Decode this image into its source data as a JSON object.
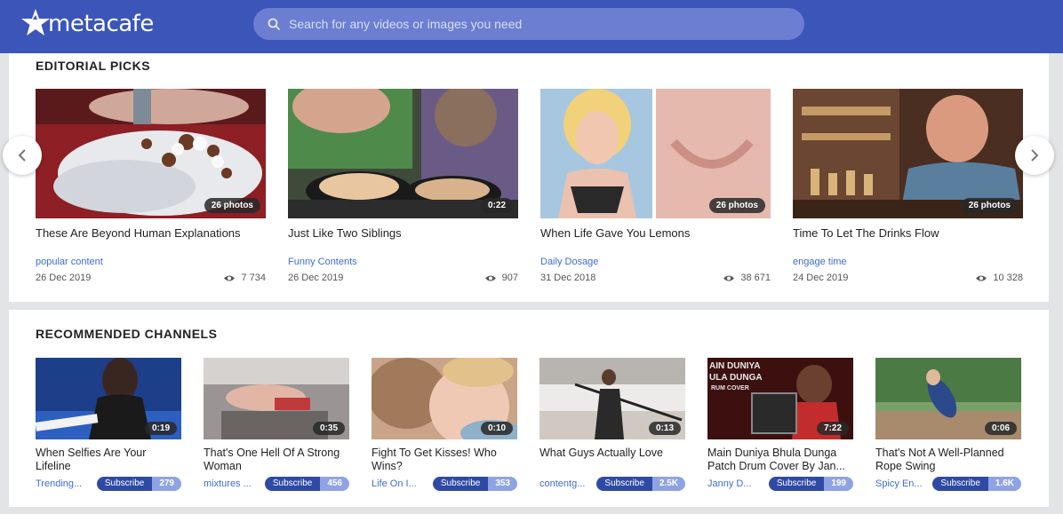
{
  "header": {
    "logo_text": "metacafe",
    "search_placeholder": "Search for any videos or images you need"
  },
  "editorial": {
    "title": "EDITORIAL PICKS",
    "items": [
      {
        "title": "These Are Beyond Human Explanations",
        "badge": "26 photos",
        "category": "popular content",
        "date": "26 Dec 2019",
        "views": "7 734"
      },
      {
        "title": "Just Like Two Siblings",
        "badge": "0:22",
        "category": "Funny Contents",
        "date": "26 Dec 2019",
        "views": "907"
      },
      {
        "title": "When Life Gave You Lemons",
        "badge": "26 photos",
        "category": "Daily Dosage",
        "date": "31 Dec 2018",
        "views": "38 671"
      },
      {
        "title": "Time To Let The Drinks Flow",
        "badge": "26 photos",
        "category": "engage time",
        "date": "24 Dec 2019",
        "views": "10 328"
      }
    ]
  },
  "channels": {
    "title": "RECOMMENDED CHANNELS",
    "subscribe_label": "Subscribe",
    "items": [
      {
        "title": "When Selfies Are Your Lifeline",
        "badge": "0:19",
        "channel": "Trending...",
        "count": "279"
      },
      {
        "title": "That's One Hell Of A Strong Woman",
        "badge": "0:35",
        "channel": "mixtures ...",
        "count": "456"
      },
      {
        "title": "Fight To Get Kisses! Who Wins?",
        "badge": "0:10",
        "channel": "Life On I...",
        "count": "353"
      },
      {
        "title": "What Guys Actually Love",
        "badge": "0:13",
        "channel": "contentg...",
        "count": "2.5K"
      },
      {
        "title": "Main Duniya Bhula Dunga Patch Drum Cover By Jan...",
        "badge": "7:22",
        "channel": "Janny D...",
        "count": "199",
        "thumb_text": [
          "AIN DUNIYA",
          "ULA DUNGA",
          "RUM COVER"
        ]
      },
      {
        "title": "That's Not A Well-Planned Rope Swing",
        "badge": "0:06",
        "channel": "Spicy En...",
        "count": "1.6K"
      }
    ]
  },
  "icons": {
    "logo": "star-logo-icon",
    "search": "search-icon",
    "views": "eye-icon",
    "prev": "chevron-left-icon",
    "next": "chevron-right-icon"
  },
  "colors": {
    "header_bg": "#3b55b9",
    "search_bg": "#6b7ed1",
    "link": "#3f6bd6",
    "subscribe_bg": "#2f4aa5",
    "subscribe_count_bg": "#8fa3e4"
  }
}
